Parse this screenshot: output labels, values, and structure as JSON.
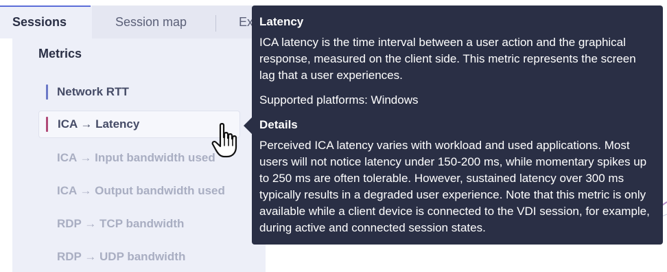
{
  "tabs": {
    "sessions": "Sessions",
    "session_map": "Session map",
    "third_partial": "Ex"
  },
  "metrics_panel": {
    "title": "Metrics",
    "items": [
      {
        "label": "Network RTT",
        "state": "active",
        "bar_color": "#6b78c7"
      },
      {
        "label": "ICA → Latency",
        "state": "selected",
        "bar_color": "#b04a78"
      },
      {
        "label": "ICA → Input bandwidth used",
        "state": "disabled"
      },
      {
        "label": "ICA → Output bandwidth used",
        "state": "disabled"
      },
      {
        "label": "RDP → TCP bandwidth",
        "state": "disabled"
      },
      {
        "label": "RDP → UDP bandwidth",
        "state": "disabled"
      }
    ]
  },
  "tooltip": {
    "title": "Latency",
    "description": "ICA latency is the time interval between a user action and the graphical response, measured on the client side. This metric represents the screen lag that a user experiences.",
    "platforms": "Supported platforms: Windows",
    "details_title": "Details",
    "details_text": "Perceived ICA latency varies with workload and used applications. Most users will not notice latency under 150-200 ms, while momentary spikes up to 250 ms are often tolerable. However, sustained latency over 300 ms typically results in a degraded user experience. Note that this metric is only available while a client device is connected to the VDI session, for example, during active and connected session states."
  },
  "cursor": {
    "icon": "hand-pointer-icon"
  },
  "colors": {
    "tooltip_bg": "#2a2f45",
    "panel_bg": "#edeff8",
    "accent": "#5b6cd8"
  }
}
